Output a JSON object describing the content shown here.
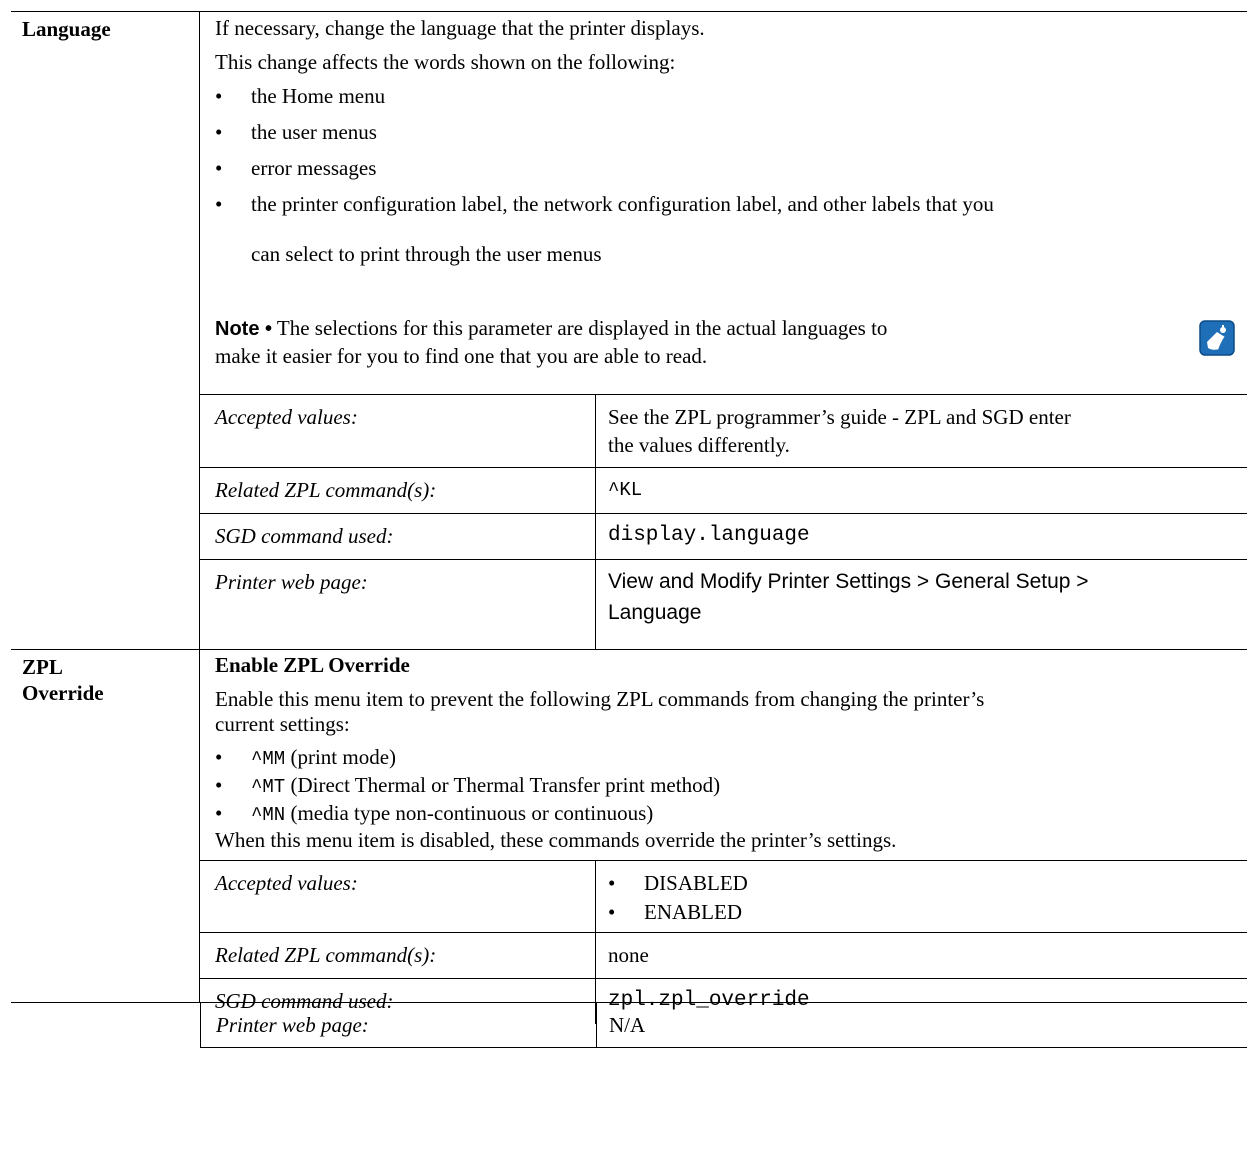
{
  "language": {
    "label": "Language",
    "intro": "If necessary, change the language that the printer displays.",
    "affects": "This change affects the words shown on the following:",
    "bullets": [
      "the Home menu",
      "the user menus",
      "error messages",
      "the printer configuration label, the network configuration label, and other labels that you",
      "can select to print through the user menus"
    ],
    "note_prefix": "Note •",
    "note_line1": " The selections for this parameter are displayed in the actual languages to",
    "note_line2": "make it easier for you to find one that you are able to read.",
    "note_icon": "note-pad-icon",
    "details": {
      "accepted_label": "Accepted values:",
      "accepted_line1": "See the ZPL programmer’s guide - ZPL and SGD enter",
      "accepted_line2": "the values differently.",
      "zpl_label": "Related ZPL command(s):",
      "zpl_value": "^KL",
      "sgd_label": "SGD command used:",
      "sgd_value": "display.language",
      "web_label": "Printer web page:",
      "web_line1": "View and Modify Printer Settings > General Setup >",
      "web_line2": "Language"
    }
  },
  "zpl_override": {
    "label_line1": "ZPL",
    "label_line2": "Override",
    "heading": "Enable ZPL Override",
    "desc_line1": "Enable this menu item to prevent the following ZPL commands from changing the printer’s",
    "desc_line2": "current settings:",
    "bullets": [
      {
        "code": "^MM",
        "text": " (print mode)"
      },
      {
        "code": "^MT",
        "text": " (Direct Thermal or Thermal Transfer print method)"
      },
      {
        "code": "^MN",
        "text": " (media type non-continuous or continuous)"
      }
    ],
    "after": "When this menu item is disabled, these commands override the printer’s settings.",
    "details": {
      "accepted_label": "Accepted values:",
      "accepted_values": [
        "DISABLED",
        "ENABLED"
      ],
      "zpl_label": "Related ZPL command(s):",
      "zpl_value": "none",
      "sgd_label": "SGD command used:",
      "sgd_value": "zpl.zpl_override",
      "web_label": "Printer web page:",
      "web_value": "N/A"
    }
  },
  "colors": {
    "note_icon_blue": "#1f6fb8",
    "border": "#000000"
  }
}
